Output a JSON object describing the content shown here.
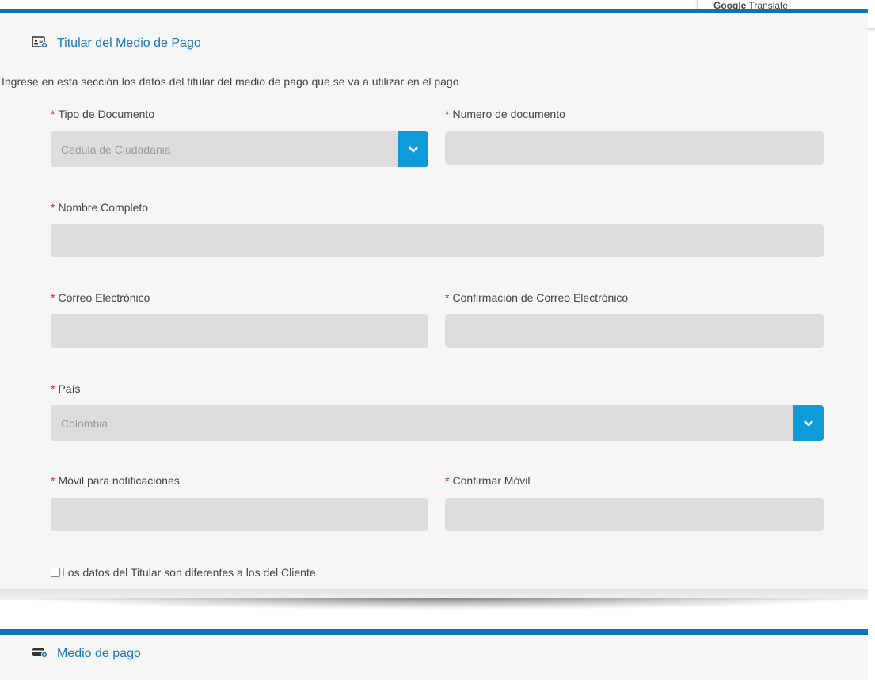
{
  "translate_popup": {
    "brand": "Google",
    "label": "Translate"
  },
  "titular": {
    "title": "Titular del Medio de Pago",
    "icon": "id-card-icon",
    "intro": "Ingrese en esta sección los datos del titular del medio de pago que se va a utilizar en el pago",
    "required_mark": "*",
    "tipo_documento": {
      "label": "Tipo de Documento",
      "value": "Cedula de Ciudadania"
    },
    "numero_documento": {
      "label": "Numero de documento",
      "value": ""
    },
    "nombre_completo": {
      "label": "Nombre Completo",
      "value": ""
    },
    "correo": {
      "label": "Correo Electrónico",
      "value": ""
    },
    "confirmacion_correo": {
      "label": "Confirmación de Correo Electrónico",
      "value": ""
    },
    "pais": {
      "label": "País",
      "value": "Colombia"
    },
    "movil": {
      "label": "Móvil para notificaciones",
      "value": ""
    },
    "confirmar_movil": {
      "label": "Confirmar Móvil",
      "value": ""
    },
    "checkbox": {
      "label": "Los datos del Titular son diferentes a los del Cliente",
      "checked": false
    }
  },
  "medio_pago": {
    "title": "Medio de pago",
    "icon": "card-icon"
  },
  "colors": {
    "accent_blue": "#0b72bd",
    "dropdown_blue": "#0f9ad9",
    "required_red": "#e2231a",
    "field_gray": "#dddddd"
  }
}
